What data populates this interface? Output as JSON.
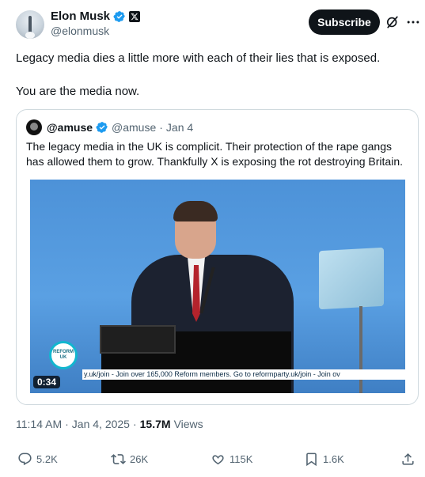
{
  "author": {
    "name": "Elon Musk",
    "handle": "@elonmusk",
    "verified_color": "#1d9bf0",
    "affiliation_badge": "x-logo-icon"
  },
  "header": {
    "subscribe_label": "Subscribe",
    "grok_icon": "grok-icon",
    "more_icon": "more-icon"
  },
  "tweet": {
    "text_line1": "Legacy media dies a little more with each of their lies that is exposed.",
    "text_line2": "You are the media now."
  },
  "quote": {
    "name": "@amuse",
    "handle": "@amuse",
    "date": "Jan 4",
    "separator": "·",
    "text": "The legacy media in the UK is complicit. Their protection of the rape gangs has allowed them to grow. Thankfully X is exposing the rot destroying Britain.",
    "video": {
      "duration": "0:34",
      "badge_line1": "REFORM",
      "badge_line2": "UK",
      "ticker": "y.uk/join   -   Join over 165,000 Reform members. Go to reformparty.uk/join   -   Join ov"
    }
  },
  "meta": {
    "time": "11:14 AM",
    "separator": "·",
    "date": "Jan 4, 2025",
    "separator2": "·",
    "views_count": "15.7M",
    "views_label": "Views"
  },
  "actions": {
    "replies": "5.2K",
    "reposts": "26K",
    "likes": "115K",
    "bookmarks": "1.6K"
  },
  "colors": {
    "text_primary": "#0f1419",
    "text_secondary": "#536471",
    "border": "#cfd9de",
    "verified": "#1d9bf0"
  }
}
